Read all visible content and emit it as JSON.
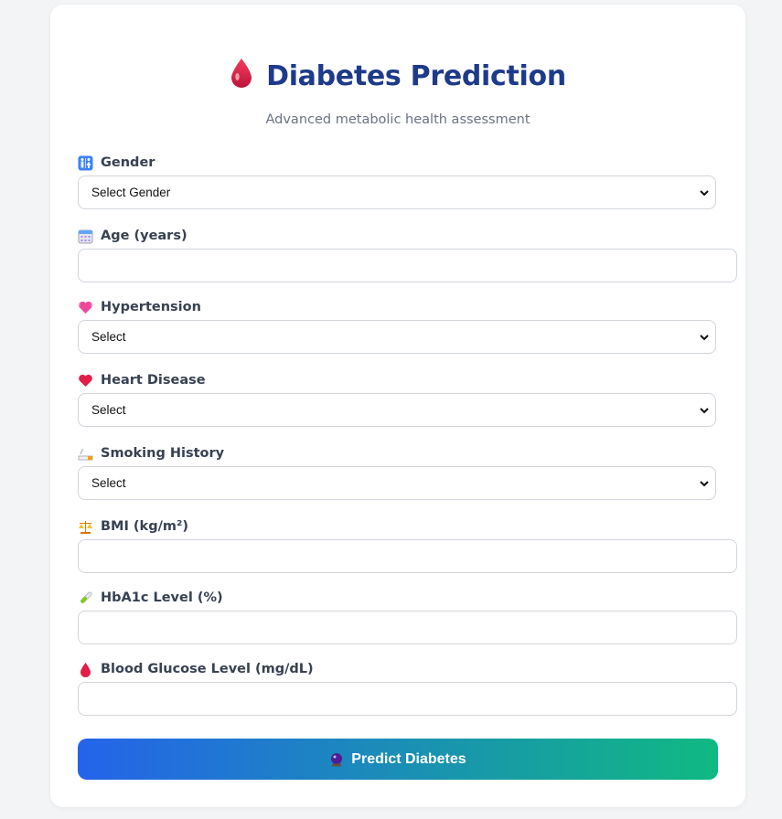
{
  "header": {
    "title": "Diabetes Prediction",
    "subtitle": "Advanced metabolic health assessment"
  },
  "fields": {
    "gender": {
      "label": "Gender",
      "icon": "restroom-icon",
      "selected": "Select Gender"
    },
    "age": {
      "label": "Age (years)",
      "icon": "calendar-icon",
      "value": ""
    },
    "hypertension": {
      "label": "Hypertension",
      "icon": "heart-icon",
      "selected": "Select"
    },
    "heart_disease": {
      "label": "Heart Disease",
      "icon": "heart-icon",
      "selected": "Select"
    },
    "smoking_history": {
      "label": "Smoking History",
      "icon": "cigarette-icon",
      "selected": "Select"
    },
    "bmi": {
      "label": "BMI (kg/m²)",
      "icon": "scale-icon",
      "value": ""
    },
    "hba1c": {
      "label": "HbA1c Level (%)",
      "icon": "test-tube-icon",
      "value": ""
    },
    "glucose": {
      "label": "Blood Glucose Level (mg/dL)",
      "icon": "blood-drop-icon",
      "value": ""
    }
  },
  "submit": {
    "label": "Predict Diabetes",
    "icon": "crystal-ball-icon"
  },
  "colors": {
    "title": "#1e3a8a",
    "button_gradient_start": "#2563eb",
    "button_gradient_end": "#10b981"
  }
}
